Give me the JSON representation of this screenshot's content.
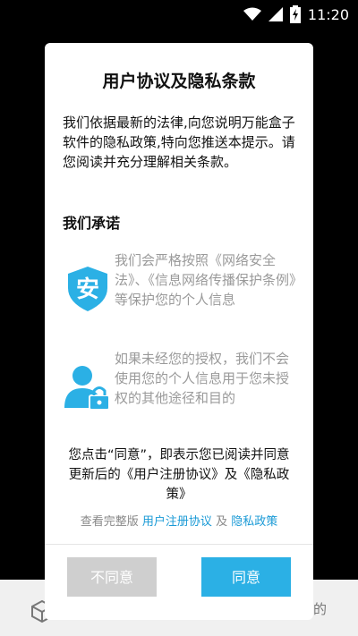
{
  "status_bar": {
    "time": "11:20",
    "icons": [
      "wifi-icon",
      "signal-icon",
      "battery-charging-icon"
    ]
  },
  "background": {
    "partial_text": "的"
  },
  "dialog": {
    "title": "用户协议及隐私条款",
    "intro": "我们依据最新的法律,向您说明万能盒子软件的隐私政策,特向您推送本提示。请您阅读并充分理解相关条款。",
    "promise_heading": "我们承诺",
    "promises": [
      {
        "icon": "security-shield-icon",
        "text": "我们会严格按照《网络安全法》、《信息网络传播保护条例》等保护您的个人信息"
      },
      {
        "icon": "user-lock-icon",
        "text": "如果未经您的授权，我们不会使用您的个人信息用于您未授权的其他途径和目的"
      }
    ],
    "consent_text": "您点击“同意”，即表示您已阅读并同意更新后的《用户注册协议》及《隐私政策》",
    "links": {
      "prefix": "查看完整版",
      "user_agreement": "用户注册协议",
      "conjunction": "及",
      "privacy_policy": "隐私政策"
    },
    "buttons": {
      "disagree": "不同意",
      "agree": "同意"
    }
  },
  "colors": {
    "accent": "#2bb0e5",
    "link": "#1a9ad6",
    "disabled_button": "#cfcfcf",
    "muted_text": "#9a9a9a"
  }
}
